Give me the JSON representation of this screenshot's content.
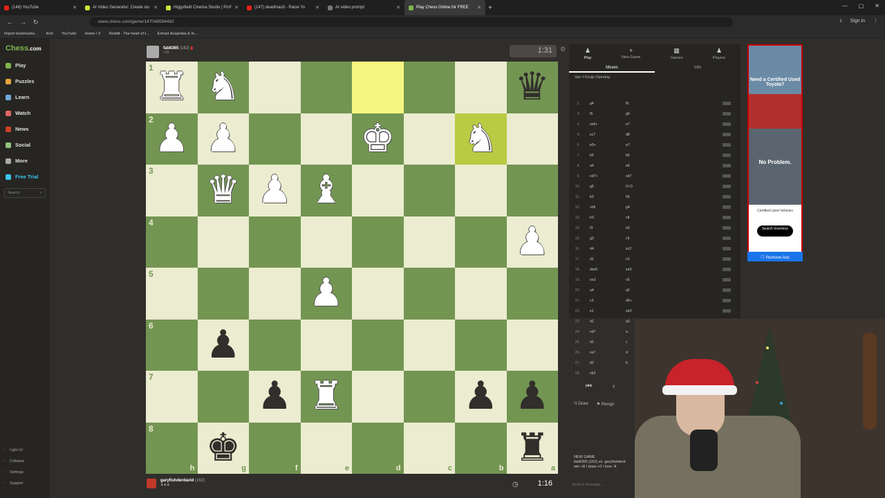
{
  "browser": {
    "tabs": [
      {
        "title": "(146) YouTube",
        "color": "#e62117"
      },
      {
        "title": "AI Video Generator: Create stu",
        "color": "#c8e63c"
      },
      {
        "title": "Higgsfield Cinema Studio | Prof",
        "color": "#c8e63c"
      },
      {
        "title": "(147) deadmau5 - Raise Yo",
        "color": "#e62117"
      },
      {
        "title": "AI video prompt",
        "color": "#777777"
      },
      {
        "title": "Play Chess Online for FREE",
        "color": "#81b64c"
      }
    ],
    "url": "www.chess.com/game/147048594482",
    "bookmarks": [
      "Import bookmarks...",
      "Kick",
      "YouTube",
      "Home / X",
      "Reddit - The heart of t...",
      "Extract Acapellas & In..."
    ],
    "signin": "Sign in"
  },
  "sidebar": {
    "logo_prefix": "Chess",
    "logo_suffix": ".com",
    "items": [
      {
        "label": "Play",
        "color": "#81b64c"
      },
      {
        "label": "Puzzles",
        "color": "#e8a33c"
      },
      {
        "label": "Learn",
        "color": "#6fa8dc"
      },
      {
        "label": "Watch",
        "color": "#e06666"
      },
      {
        "label": "News",
        "color": "#cc4125"
      },
      {
        "label": "Social",
        "color": "#93c47d"
      },
      {
        "label": "More",
        "color": "#aaaaaa"
      },
      {
        "label": "Free Trial",
        "color": "#3cc3f0"
      }
    ],
    "search_placeholder": "Search",
    "footer": [
      "Light UI",
      "Collapse",
      "Settings",
      "Support"
    ]
  },
  "game": {
    "opponent": {
      "name": "fab8365",
      "rating": "(162)",
      "sub": "+15"
    },
    "player": {
      "name": "garyfishderdavid",
      "rating": "(162)"
    },
    "opponent_clock": "1:31",
    "player_clock": "1:16",
    "ranks": [
      "1",
      "2",
      "3",
      "4",
      "5",
      "6",
      "7",
      "8"
    ],
    "files": [
      "h",
      "g",
      "f",
      "e",
      "d",
      "c",
      "b",
      "a"
    ],
    "highlights": [
      "0,4",
      "1,6"
    ],
    "pieces": [
      {
        "sq": "0,0",
        "c": "w",
        "g": "♜"
      },
      {
        "sq": "0,1",
        "c": "w",
        "g": "♞"
      },
      {
        "sq": "0,7",
        "c": "b",
        "g": "♛"
      },
      {
        "sq": "1,0",
        "c": "w",
        "g": "♟"
      },
      {
        "sq": "1,1",
        "c": "w",
        "g": "♟"
      },
      {
        "sq": "1,4",
        "c": "w",
        "g": "♚"
      },
      {
        "sq": "1,6",
        "c": "w",
        "g": "♞"
      },
      {
        "sq": "2,1",
        "c": "w",
        "g": "♛"
      },
      {
        "sq": "2,2",
        "c": "w",
        "g": "♟"
      },
      {
        "sq": "2,3",
        "c": "w",
        "g": "♝"
      },
      {
        "sq": "3,7",
        "c": "w",
        "g": "♟"
      },
      {
        "sq": "4,3",
        "c": "w",
        "g": "♟"
      },
      {
        "sq": "5,1",
        "c": "b",
        "g": "♟"
      },
      {
        "sq": "6,2",
        "c": "b",
        "g": "♟"
      },
      {
        "sq": "6,3",
        "c": "w",
        "g": "♜"
      },
      {
        "sq": "6,6",
        "c": "b",
        "g": "♟"
      },
      {
        "sq": "6,7",
        "c": "b",
        "g": "♟"
      },
      {
        "sq": "7,1",
        "c": "b",
        "g": "♚"
      },
      {
        "sq": "7,7",
        "c": "b",
        "g": "♜"
      }
    ]
  },
  "panel": {
    "tabs": [
      {
        "label": "Play",
        "icon": "♟"
      },
      {
        "label": "New Game",
        "icon": "+"
      },
      {
        "label": "Games",
        "icon": "▦"
      },
      {
        "label": "Players",
        "icon": "♟"
      }
    ],
    "subtabs": [
      "Moves",
      "Info"
    ],
    "opening": "Van 't Kruijs Opening",
    "moves": [
      {
        "n": "2.",
        "w": "g4",
        "b": "f6"
      },
      {
        "n": "3.",
        "w": "f5",
        "b": "g6"
      },
      {
        "n": "4.",
        "w": "xe5+",
        "b": "e7"
      },
      {
        "n": "5.",
        "w": "xc7",
        "b": "d8"
      },
      {
        "n": "6.",
        "w": "e5+",
        "b": "e7"
      },
      {
        "n": "7.",
        "w": "b5",
        "b": "b6"
      },
      {
        "n": "8.",
        "w": "a4",
        "b": "e6"
      },
      {
        "n": "9.",
        "w": "xd7+",
        "b": "xd7"
      },
      {
        "n": "10.",
        "w": "g5",
        "b": "O-O"
      },
      {
        "n": "11.",
        "w": "b3",
        "b": "h6"
      },
      {
        "n": "12.",
        "w": "xh6",
        "b": "g4"
      },
      {
        "n": "13.",
        "w": "h3",
        "b": "c8"
      },
      {
        "n": "14.",
        "w": "f3",
        "b": "e5"
      },
      {
        "n": "15.",
        "w": "g3",
        "b": "c5"
      },
      {
        "n": "16.",
        "w": "d4",
        "b": "xc2"
      },
      {
        "n": "17.",
        "w": "d1",
        "b": "c3"
      },
      {
        "n": "18.",
        "w": "dxe5",
        "b": "xe3"
      },
      {
        "n": "19.",
        "w": "xe3",
        "b": "c6"
      },
      {
        "n": "20.",
        "w": "a4",
        "b": "a5"
      },
      {
        "n": "21.",
        "w": "c3",
        "b": "d6+"
      },
      {
        "n": "22.",
        "w": "e1",
        "b": "xb3"
      },
      {
        "n": "23.",
        "w": "d1",
        "b": "a3"
      },
      {
        "n": "24.",
        "w": "xd7",
        "b": "a"
      },
      {
        "n": "25.",
        "w": "d1",
        "b": "c"
      },
      {
        "n": "26.",
        "w": "xe7",
        "b": "d"
      },
      {
        "n": "27.",
        "w": "d2",
        "b": "b"
      },
      {
        "n": "28.",
        "w": "xb2",
        "b": ""
      }
    ],
    "draw": "Draw",
    "resign": "Resign",
    "new_game_title": "NEW GAME",
    "new_game_line1": "fab8365 (162) vs. garyfishderd",
    "new_game_line2": "win +8 / draw +0 / lose -8",
    "message_placeholder": "Send a message..."
  },
  "ad": {
    "headline": "Need a Certified Used Toyota?",
    "no_problem": "No Problem.",
    "certified": "Certified Used Vehicles",
    "search": "Search Inventory",
    "remove": "Remove Ads"
  }
}
